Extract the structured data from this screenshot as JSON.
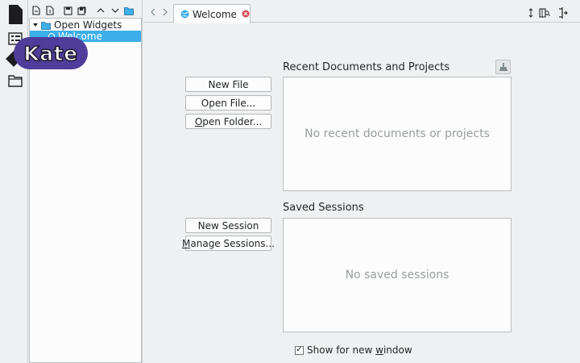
{
  "app": {
    "logo_text": "Kate"
  },
  "documents_panel": {
    "tree": [
      {
        "label": "Open Widgets",
        "expanded": true,
        "icon": "folder-icon"
      },
      {
        "label": "Welcome",
        "selected": true,
        "icon": "welcome-icon"
      }
    ]
  },
  "tabs": [
    {
      "label": "Welcome",
      "icon": "globe-icon",
      "active": true
    }
  ],
  "welcome": {
    "recent_title": "Recent Documents and Projects",
    "recent_empty": "No recent documents or projects",
    "buttons": {
      "new_file": "New File",
      "open_file": "Open File...",
      "open_folder_mnemonic": "O",
      "open_folder_rest": "pen Folder...",
      "new_session": "New Session",
      "manage_sessions_mnemonic": "M",
      "manage_sessions_rest": "anage Sessions..."
    },
    "sessions_title": "Saved Sessions",
    "sessions_empty": "No saved sessions",
    "show_for_new_window_prefix": "Show for new ",
    "show_for_new_window_mnemonic": "w",
    "show_for_new_window_suffix": "indow",
    "show_for_new_window_checked": true,
    "check_mark": "✓"
  },
  "colors": {
    "accent": "#3daee9",
    "logo_bg": "#4e3d9a"
  }
}
